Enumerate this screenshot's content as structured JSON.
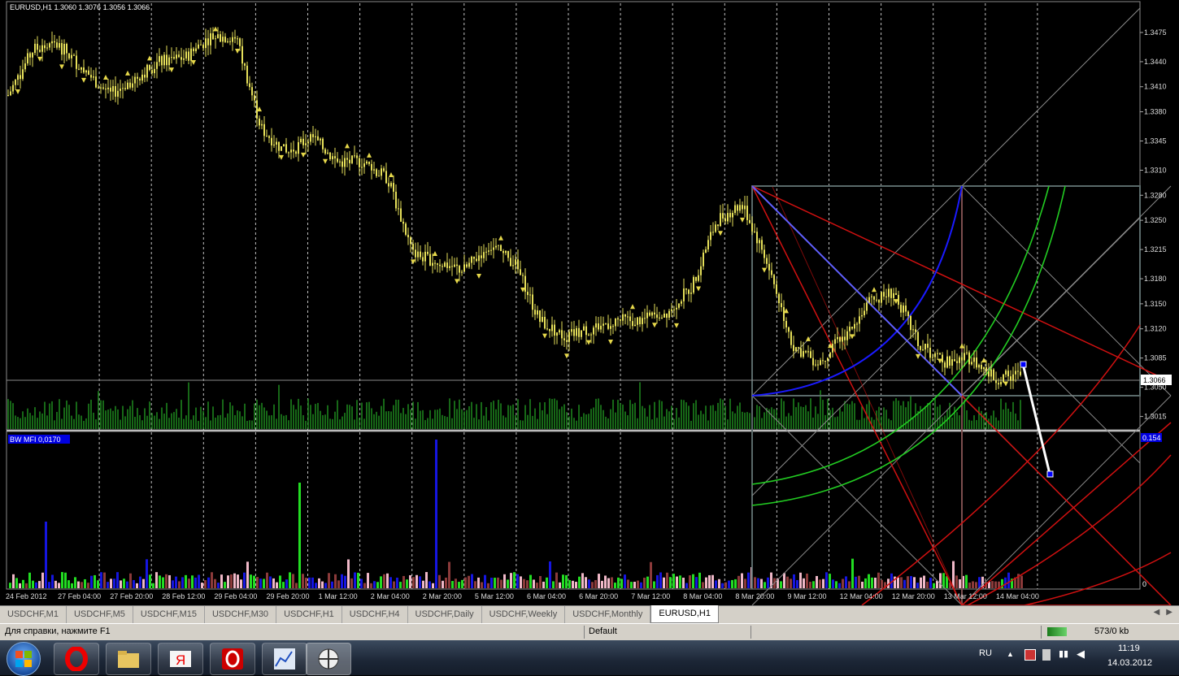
{
  "chart_header": {
    "symbol_info": "EURUSD,H1  1.3060 1.3076 1.3056 1.3066"
  },
  "indicator": {
    "label": "BW MFI 0,0170",
    "top_value": "0.154",
    "zero_value": "0"
  },
  "price_axis": {
    "labels": [
      "1.3475",
      "1.3440",
      "1.3410",
      "1.3380",
      "1.3345",
      "1.3310",
      "1.3280",
      "1.3250",
      "1.3215",
      "1.3180",
      "1.3150",
      "1.3120",
      "1.3085",
      "1.3050",
      "1.3015"
    ],
    "current_price": "1.3066"
  },
  "time_axis": {
    "labels": [
      "24 Feb 2012",
      "27 Feb 04:00",
      "27 Feb 20:00",
      "28 Feb 12:00",
      "29 Feb 04:00",
      "29 Feb 20:00",
      "1 Mar 12:00",
      "2 Mar 04:00",
      "2 Mar 20:00",
      "5 Mar 12:00",
      "6 Mar 04:00",
      "6 Mar 20:00",
      "7 Mar 12:00",
      "8 Mar 04:00",
      "8 Mar 20:00",
      "9 Mar 12:00",
      "12 Mar 04:00",
      "12 Mar 20:00",
      "13 Mar 12:00",
      "14 Mar 04:00"
    ]
  },
  "tabs": [
    "USDCHF,M1",
    "USDCHF,M5",
    "USDCHF,M15",
    "USDCHF,M30",
    "USDCHF,H1",
    "USDCHF,H4",
    "USDCHF,Daily",
    "USDCHF,Weekly",
    "USDCHF,Monthly",
    "EURUSD,H1"
  ],
  "active_tab": "EURUSD,H1",
  "status": {
    "help": "Для справки, нажмите F1",
    "profile": "Default",
    "traffic": "573/0 kb"
  },
  "tray": {
    "lang": "RU",
    "time": "11:19",
    "date": "14.03.2012"
  },
  "colors": {
    "candles": "#e6e05a",
    "fractals": "#e6d84a",
    "volume": "#1f8a1f",
    "mfi_blue": "#1515e0",
    "mfi_green": "#22dd22",
    "mfi_pink": "#f0b8c8",
    "mfi_brown": "#8b3a3a",
    "gann_red": "#d01010",
    "gann_green": "#22cc22",
    "gann_grey": "#8a8a8a"
  },
  "chart_data": {
    "type": "candlestick",
    "symbol": "EURUSD",
    "timeframe": "H1",
    "ohlc_last": {
      "open": 1.306,
      "high": 1.3076,
      "low": 1.3056,
      "close": 1.3066
    },
    "close_path": [
      [
        "24 Feb 2012",
        1.34
      ],
      [
        "24 Feb",
        1.3455
      ],
      [
        "27 Feb 04:00",
        1.346
      ],
      [
        "27 Feb 12:00",
        1.343
      ],
      [
        "27 Feb 20:00",
        1.34
      ],
      [
        "28 Feb 04:00",
        1.342
      ],
      [
        "28 Feb 12:00",
        1.344
      ],
      [
        "28 Feb 20:00",
        1.3445
      ],
      [
        "29 Feb 04:00",
        1.347
      ],
      [
        "29 Feb 12:00",
        1.347
      ],
      [
        "29 Feb 16:00",
        1.336
      ],
      [
        "29 Feb 20:00",
        1.333
      ],
      [
        "1 Mar 04:00",
        1.335
      ],
      [
        "1 Mar 12:00",
        1.332
      ],
      [
        "1 Mar 20:00",
        1.332
      ],
      [
        "2 Mar 04:00",
        1.33
      ],
      [
        "2 Mar 12:00",
        1.321
      ],
      [
        "2 Mar 20:00",
        1.32
      ],
      [
        "5 Mar 04:00",
        1.319
      ],
      [
        "5 Mar 12:00",
        1.322
      ],
      [
        "5 Mar 20:00",
        1.32
      ],
      [
        "6 Mar 04:00",
        1.313
      ],
      [
        "6 Mar 12:00",
        1.311
      ],
      [
        "6 Mar 20:00",
        1.312
      ],
      [
        "7 Mar 04:00",
        1.313
      ],
      [
        "7 Mar 12:00",
        1.313
      ],
      [
        "7 Mar 20:00",
        1.314
      ],
      [
        "8 Mar 04:00",
        1.317
      ],
      [
        "8 Mar 12:00",
        1.325
      ],
      [
        "8 Mar 20:00",
        1.327
      ],
      [
        "9 Mar 04:00",
        1.32
      ],
      [
        "9 Mar 12:00",
        1.31
      ],
      [
        "9 Mar 20:00",
        1.308
      ],
      [
        "12 Mar 04:00",
        1.311
      ],
      [
        "12 Mar 12:00",
        1.315
      ],
      [
        "12 Mar 20:00",
        1.3165
      ],
      [
        "13 Mar 04:00",
        1.31
      ],
      [
        "13 Mar 12:00",
        1.308
      ],
      [
        "13 Mar 20:00",
        1.3085
      ],
      [
        "14 Mar 04:00",
        1.306
      ],
      [
        "14 Mar 11:00",
        1.3066
      ]
    ],
    "price_range": [
      1.3,
      1.351
    ],
    "indicator": {
      "name": "BW MFI",
      "range": [
        0,
        0.154
      ]
    }
  }
}
